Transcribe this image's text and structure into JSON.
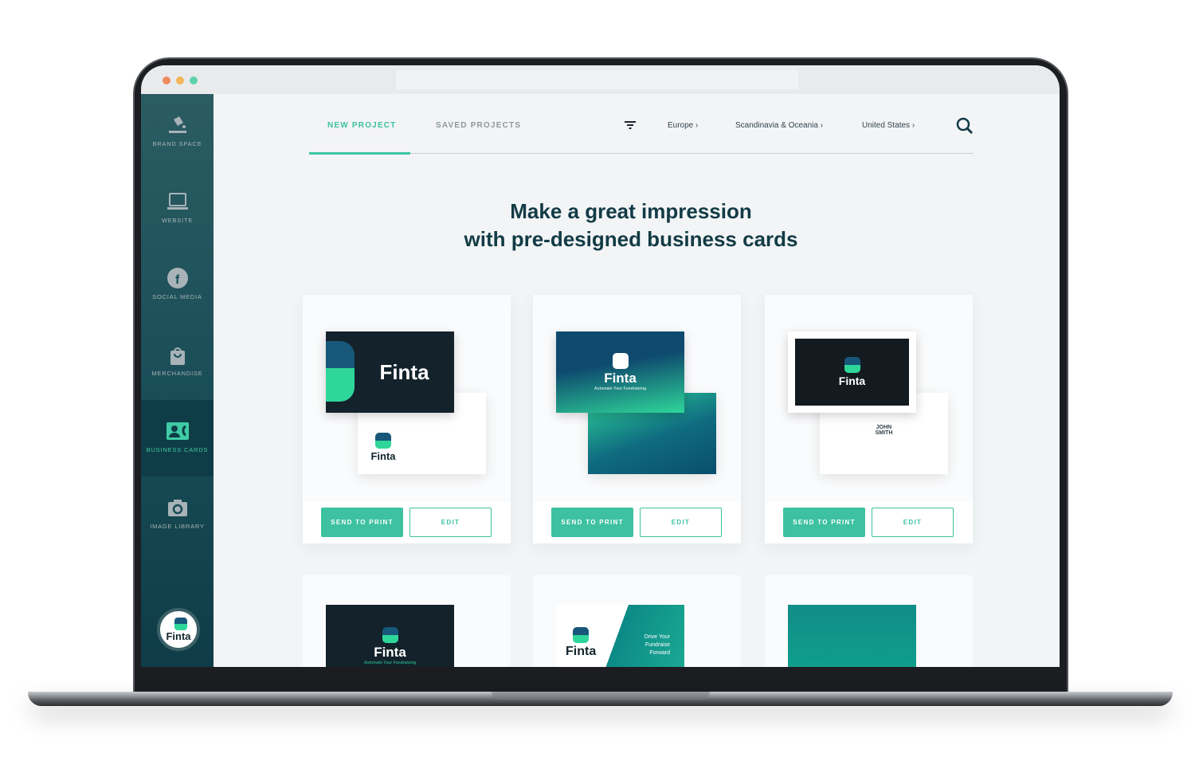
{
  "window": {
    "dots": [
      "#f08a5d",
      "#f5b55a",
      "#5fd3a8"
    ]
  },
  "sidebar": {
    "items": [
      {
        "label": "BRAND SPACE",
        "icon": "paint-bucket-icon"
      },
      {
        "label": "WEBSITE",
        "icon": "laptop-icon"
      },
      {
        "label": "SOCIAL MEDIA",
        "icon": "facebook-icon"
      },
      {
        "label": "MERCHANDISE",
        "icon": "shopping-bag-icon"
      },
      {
        "label": "BUSINESS CARDS",
        "icon": "contact-card-icon",
        "active": true
      },
      {
        "label": "IMAGE LIBRARY",
        "icon": "camera-icon"
      }
    ],
    "logo": "Finta"
  },
  "tabs": [
    {
      "label": "NEW PROJECT",
      "active": true
    },
    {
      "label": "SAVED PROJECTS"
    }
  ],
  "filters": [
    "Europe",
    "Scandinavia & Oceania",
    "United States"
  ],
  "headline": {
    "line1": "Make a great impression",
    "line2": "with pre-designed business cards"
  },
  "cards": {
    "send_label": "SEND TO PRINT",
    "edit_label": "EDIT",
    "brand": "Finta",
    "tagline": "Automate Your Fundraising",
    "name_line1": "JOHN",
    "name_line2": "SMITH",
    "slogan": [
      "Drive Your",
      "Fundraise",
      "Forward"
    ]
  },
  "colors": {
    "accent": "#3dc1a0",
    "sidebar": "#174b55",
    "heading": "#123b45"
  }
}
